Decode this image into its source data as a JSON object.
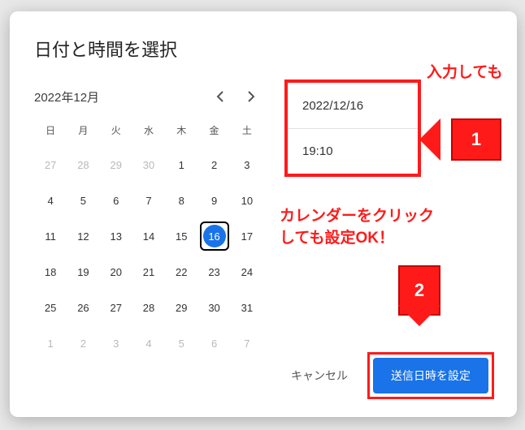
{
  "title": "日付と時間を選択",
  "calendar": {
    "month_label": "2022年12月",
    "dow": [
      "日",
      "月",
      "火",
      "水",
      "木",
      "金",
      "土"
    ],
    "days": [
      {
        "n": "27",
        "m": true
      },
      {
        "n": "28",
        "m": true
      },
      {
        "n": "29",
        "m": true
      },
      {
        "n": "30",
        "m": true
      },
      {
        "n": "1"
      },
      {
        "n": "2"
      },
      {
        "n": "3"
      },
      {
        "n": "4"
      },
      {
        "n": "5"
      },
      {
        "n": "6"
      },
      {
        "n": "7"
      },
      {
        "n": "8"
      },
      {
        "n": "9"
      },
      {
        "n": "10"
      },
      {
        "n": "11"
      },
      {
        "n": "12"
      },
      {
        "n": "13"
      },
      {
        "n": "14"
      },
      {
        "n": "15"
      },
      {
        "n": "16",
        "sel": true
      },
      {
        "n": "17"
      },
      {
        "n": "18"
      },
      {
        "n": "19"
      },
      {
        "n": "20"
      },
      {
        "n": "21"
      },
      {
        "n": "22"
      },
      {
        "n": "23"
      },
      {
        "n": "24"
      },
      {
        "n": "25"
      },
      {
        "n": "26"
      },
      {
        "n": "27"
      },
      {
        "n": "28"
      },
      {
        "n": "29"
      },
      {
        "n": "30"
      },
      {
        "n": "31"
      },
      {
        "n": "1",
        "m": true
      },
      {
        "n": "2",
        "m": true
      },
      {
        "n": "3",
        "m": true
      },
      {
        "n": "4",
        "m": true
      },
      {
        "n": "5",
        "m": true
      },
      {
        "n": "6",
        "m": true
      },
      {
        "n": "7",
        "m": true
      }
    ]
  },
  "date_value": "2022/12/16",
  "time_value": "19:10",
  "annotation_top": "入力しても",
  "annotation_mid_l1": "カレンダーをクリック",
  "annotation_mid_l2": "しても設定OK！",
  "badge1": "1",
  "badge2": "2",
  "cancel": "キャンセル",
  "submit": "送信日時を設定"
}
